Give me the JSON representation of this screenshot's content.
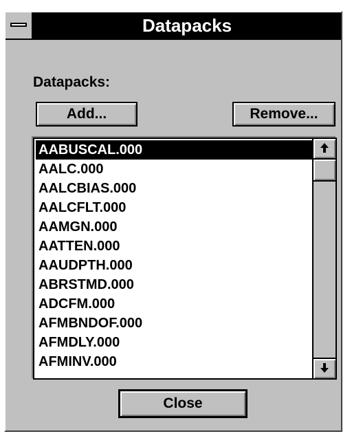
{
  "window": {
    "title": "Datapacks"
  },
  "panel": {
    "label": "Datapacks:",
    "add_label": "Add...",
    "remove_label": "Remove...",
    "close_label": "Close"
  },
  "list": {
    "selected": "AABUSCAL.000",
    "items": [
      "AABUSCAL.000",
      "AALC.000",
      "AALCBIAS.000",
      "AALCFLT.000",
      "AAMGN.000",
      "AATTEN.000",
      "AAUDPTH.000",
      "ABRSTMD.000",
      "ADCFM.000",
      "AFMBNDOF.000",
      "AFMDLY.000",
      "AFMINV.000"
    ]
  },
  "icons": {
    "system_menu": "system-menu-icon",
    "scroll_up": "arrow-up-icon",
    "scroll_down": "arrow-down-icon"
  }
}
